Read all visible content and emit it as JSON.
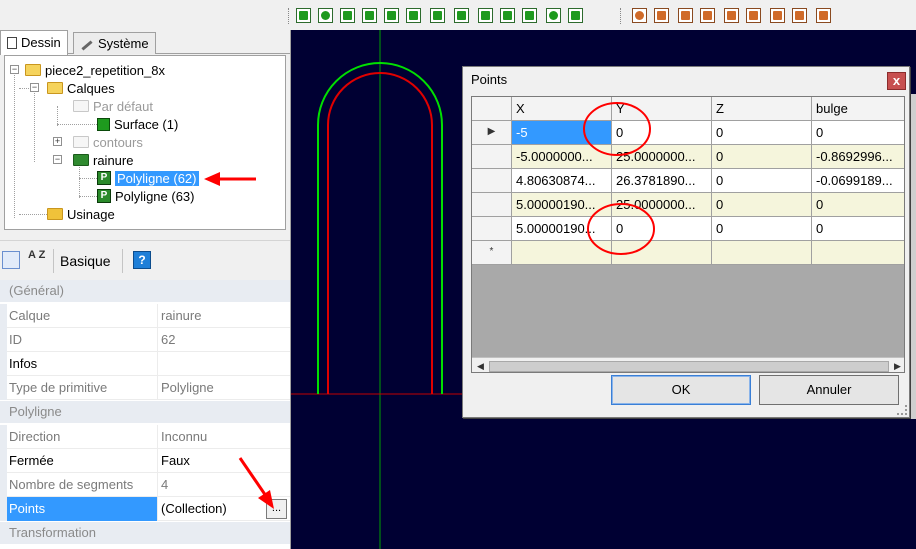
{
  "tabs": [
    {
      "label": "Dessin",
      "icon": "page-icon",
      "active": true
    },
    {
      "label": "Système",
      "icon": "wrench-icon",
      "active": false
    }
  ],
  "tree": {
    "root": "piece2_repetition_8x",
    "calques": "Calques",
    "par_defaut": "Par défaut",
    "surface": "Surface (1)",
    "contours": "contours",
    "rainure": "rainure",
    "polyligne_62": "Polyligne (62)",
    "polyligne_63": "Polyligne (63)",
    "usinage": "Usinage"
  },
  "props_toolbar": {
    "sort_categorized_icon": "categorized-icon",
    "sort_alpha_label": "A Z",
    "basique": "Basique",
    "help_label": "?"
  },
  "properties": {
    "cat_general": "(Général)",
    "calque": {
      "name": "Calque",
      "value": "rainure"
    },
    "id": {
      "name": "ID",
      "value": "62"
    },
    "infos": {
      "name": "Infos",
      "value": ""
    },
    "type": {
      "name": "Type de primitive",
      "value": "Polyligne"
    },
    "cat_polyligne": "Polyligne",
    "direction": {
      "name": "Direction",
      "value": "Inconnu"
    },
    "fermee": {
      "name": "Fermée",
      "value": "Faux"
    },
    "segments": {
      "name": "Nombre de segments",
      "value": "4"
    },
    "points": {
      "name": "Points",
      "value": "(Collection)"
    },
    "points_button": "...",
    "cat_transformation": "Transformation"
  },
  "dialog": {
    "title": "Points",
    "close_label": "x",
    "columns": [
      "X",
      "Y",
      "Z",
      "bulge"
    ],
    "current_row_marker": "▶",
    "new_row_marker": "*",
    "rows": [
      {
        "x": "-5",
        "y": "0",
        "z": "0",
        "bulge": "0"
      },
      {
        "x": "-5.0000000...",
        "y": "25.0000000...",
        "z": "0",
        "bulge": "-0.8692996..."
      },
      {
        "x": "4.80630874...",
        "y": "26.3781890...",
        "z": "0",
        "bulge": "-0.0699189..."
      },
      {
        "x": "5.00000190...",
        "y": "25.0000000...",
        "z": "0",
        "bulge": "0"
      },
      {
        "x": "5.00000190...",
        "y": "0",
        "z": "0",
        "bulge": "0"
      }
    ],
    "ok_label": "OK",
    "cancel_label": "Annuler",
    "scroll_left": "◀",
    "scroll_right": "▶"
  },
  "colors": {
    "canvas_bg": "#000033",
    "contour_green": "#00e000",
    "contour_red": "#e00000",
    "annotation_red": "#ff0000",
    "selection_blue": "#3399ff"
  }
}
